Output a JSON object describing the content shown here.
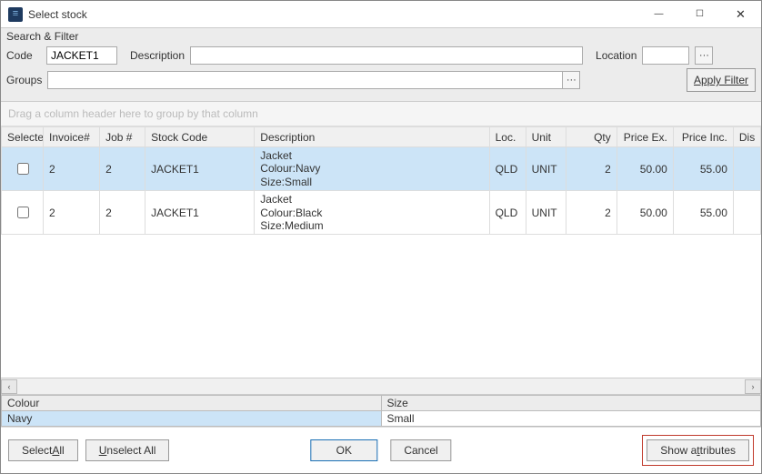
{
  "window": {
    "title": "Select stock",
    "minimize": "—",
    "maximize": "☐",
    "close": "✕"
  },
  "filter": {
    "panel_title": "Search & Filter",
    "code_label": "Code",
    "code_value": "JACKET1",
    "description_label": "Description",
    "description_value": "",
    "location_label": "Location",
    "location_value": "",
    "location_more": "···",
    "groups_label": "Groups",
    "groups_value": "",
    "groups_more": "···",
    "apply_label": "Apply Filter"
  },
  "groupby_hint": "Drag a column header here to group by that column",
  "columns": {
    "selected": "Selected",
    "invoice": "Invoice#",
    "job": "Job #",
    "stock_code": "Stock Code",
    "description": "Description",
    "loc": "Loc.",
    "unit": "Unit",
    "qty": "Qty",
    "price_ex": "Price Ex.",
    "price_inc": "Price Inc.",
    "dis": "Dis"
  },
  "rows": [
    {
      "selected": false,
      "invoice": "2",
      "job": "2",
      "stock_code": "JACKET1",
      "description": "Jacket\nColour:Navy\nSize:Small",
      "loc": "QLD",
      "unit": "UNIT",
      "qty": "2",
      "price_ex": "50.00",
      "price_inc": "55.00",
      "highlight": true
    },
    {
      "selected": false,
      "invoice": "2",
      "job": "2",
      "stock_code": "JACKET1",
      "description": "Jacket\nColour:Black\nSize:Medium",
      "loc": "QLD",
      "unit": "UNIT",
      "qty": "2",
      "price_ex": "50.00",
      "price_inc": "55.00",
      "highlight": false
    }
  ],
  "attributes": {
    "headers": [
      "Colour",
      "Size"
    ],
    "values": [
      "Navy",
      "Small"
    ]
  },
  "buttons": {
    "select_all_pre": "Select ",
    "select_all_u": "A",
    "select_all_post": "ll",
    "unselect_all_u": "U",
    "unselect_all_post": "nselect All",
    "ok": "OK",
    "cancel": "Cancel",
    "show_attr_pre": "Show a",
    "show_attr_u": "t",
    "show_attr_post": "tributes"
  },
  "scroll": {
    "left": "‹",
    "right": "›"
  }
}
